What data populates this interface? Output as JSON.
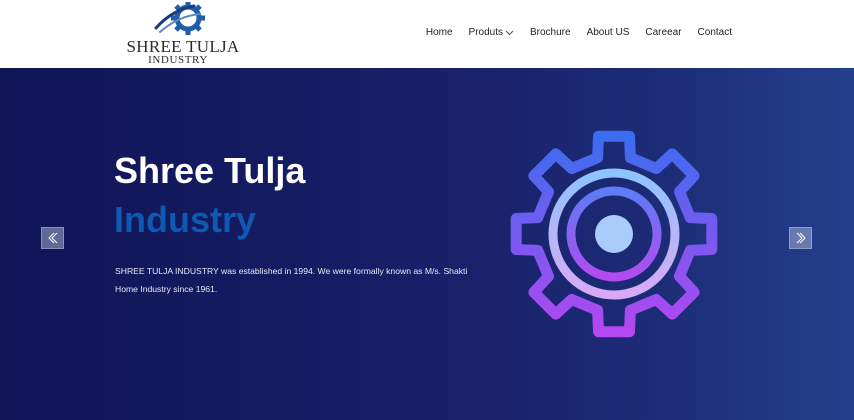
{
  "brand": {
    "line1": "SHREE TULJA",
    "line2": "INDUSTRY",
    "mark_icon": "gear-logo-icon",
    "mark_color": "#1d5fa8"
  },
  "nav": {
    "items": [
      {
        "label": "Home"
      },
      {
        "label": "Produts",
        "has_dropdown": true
      },
      {
        "label": "Brochure"
      },
      {
        "label": "About US"
      },
      {
        "label": "Careear"
      },
      {
        "label": "Contact"
      }
    ]
  },
  "hero": {
    "title_line1": "Shree Tulja",
    "title_line2": "Industry",
    "description": "SHREE TULJA INDUSTRY was established in 1994. We were formally known as M/s. Shakti Home Industry since 1961.",
    "prev_icon": "chevron-left-icon",
    "next_icon": "chevron-right-icon",
    "illustration_icon": "gear-illustration-icon",
    "colors": {
      "background_start": "#101556",
      "background_end": "#253f8c",
      "title_accent": "#0f59b3",
      "gear_gradient_start": "#3a6df0",
      "gear_gradient_end": "#b347f0"
    }
  }
}
